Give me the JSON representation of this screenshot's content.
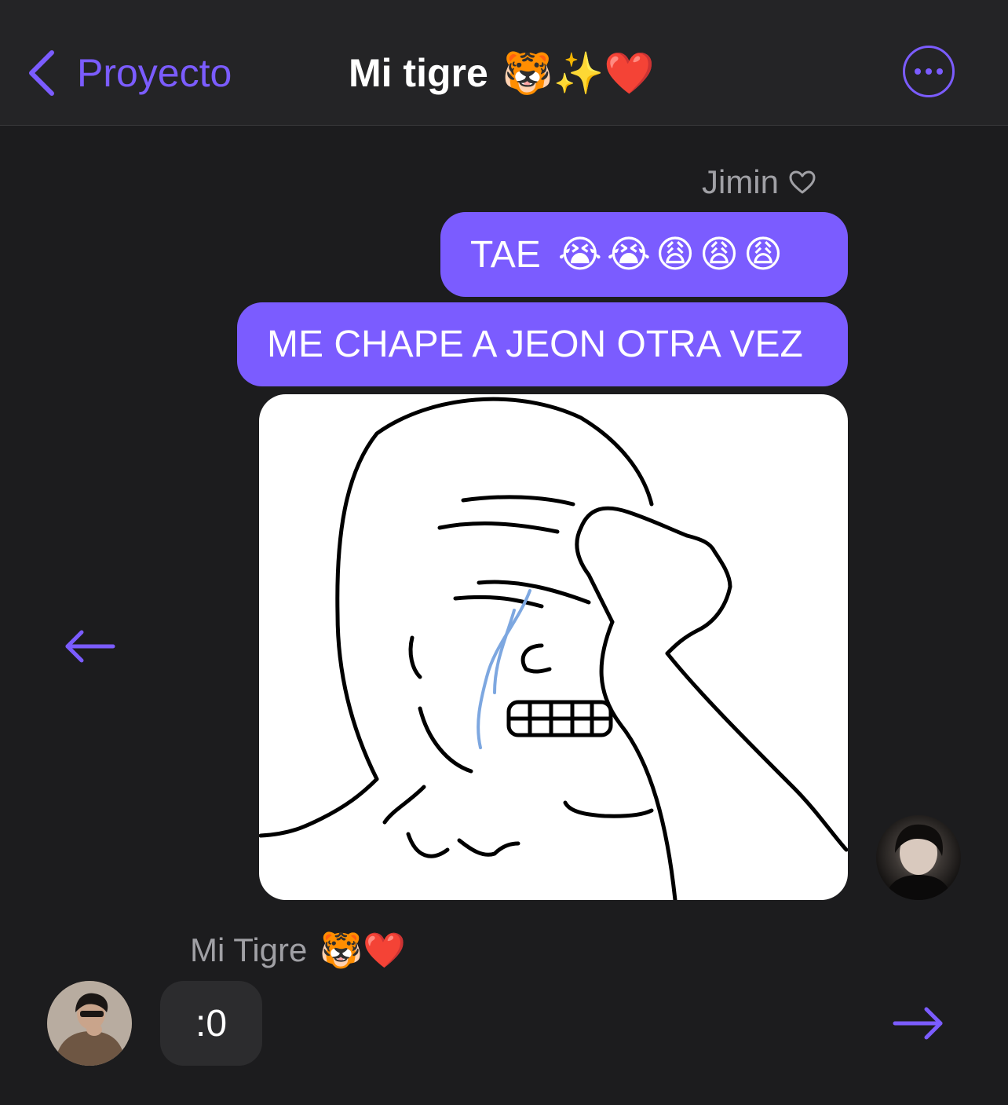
{
  "header": {
    "back_label": "Proyecto",
    "title": "Mi tigre",
    "title_emojis": "🐯✨❤️",
    "more_icon": "ellipsis-circle-icon",
    "accent_color": "#7b5cff"
  },
  "messages": [
    {
      "sender": "Jimin",
      "sender_icon": "heart-outline-icon",
      "items": [
        {
          "type": "text",
          "text": "TAE",
          "emojis": "😭😭😩😩😩"
        },
        {
          "type": "text",
          "text": "ME CHAPE A JEON OTRA VEZ"
        },
        {
          "type": "image",
          "image": "crying-wojak-meme"
        }
      ]
    },
    {
      "sender": "Mi Tigre",
      "sender_emojis": "🐯❤️",
      "items": [
        {
          "type": "text",
          "text": ":0"
        }
      ]
    }
  ],
  "nav": {
    "prev_icon": "arrow-left-icon",
    "next_icon": "arrow-right-icon"
  }
}
